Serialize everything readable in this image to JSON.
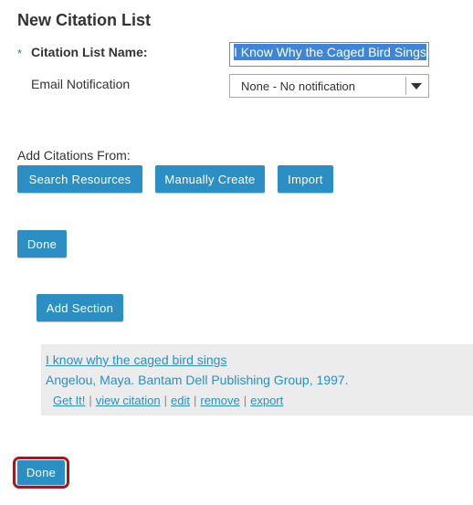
{
  "page": {
    "title": "New Citation List"
  },
  "form": {
    "required_marker": "*",
    "name_label": "Citation List Name:",
    "name_value": "I Know Why the Caged Bird Sings",
    "email_label": "Email Notification",
    "email_value": "None - No notification"
  },
  "add_from": {
    "label": "Add Citations From:",
    "search_label": "Search Resources",
    "manual_label": "Manually Create",
    "import_label": "Import"
  },
  "done_top_label": "Done",
  "add_section_label": "Add Section",
  "citation": {
    "title": "I know why the caged bird sings",
    "author_line": "Angelou, Maya. Bantam Dell Publishing Group, 1997.",
    "actions": {
      "get_it": "Get It!",
      "view": "view citation",
      "edit": "edit",
      "remove": "remove",
      "export": "export",
      "separator": "|"
    }
  },
  "done_bottom_label": "Done",
  "colors": {
    "button": "#2b8fc4",
    "link": "#2b8fc4",
    "highlight": "#a01b21",
    "citation_bg": "#ececec"
  }
}
